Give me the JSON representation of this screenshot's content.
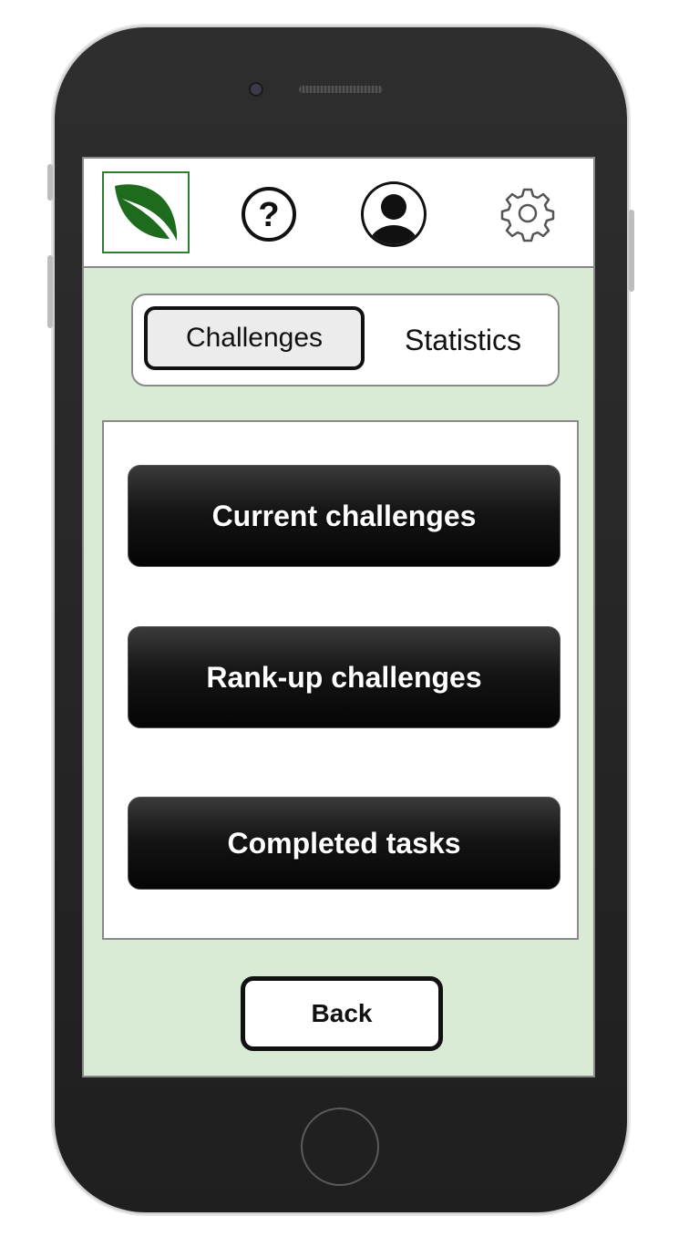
{
  "header": {
    "logo_icon": "leaf-icon",
    "help_icon": "question-mark-icon",
    "profile_icon": "user-avatar-icon",
    "settings_icon": "gear-icon",
    "brand_color": "#1e6b1e"
  },
  "tabs": {
    "active": "Challenges",
    "inactive": "Statistics"
  },
  "menu": {
    "current": "Current challenges",
    "rankup": "Rank-up challenges",
    "completed": "Completed tasks"
  },
  "footer": {
    "back_label": "Back"
  },
  "colors": {
    "screen_background": "#d9ead5",
    "button_dark": "#111111"
  }
}
